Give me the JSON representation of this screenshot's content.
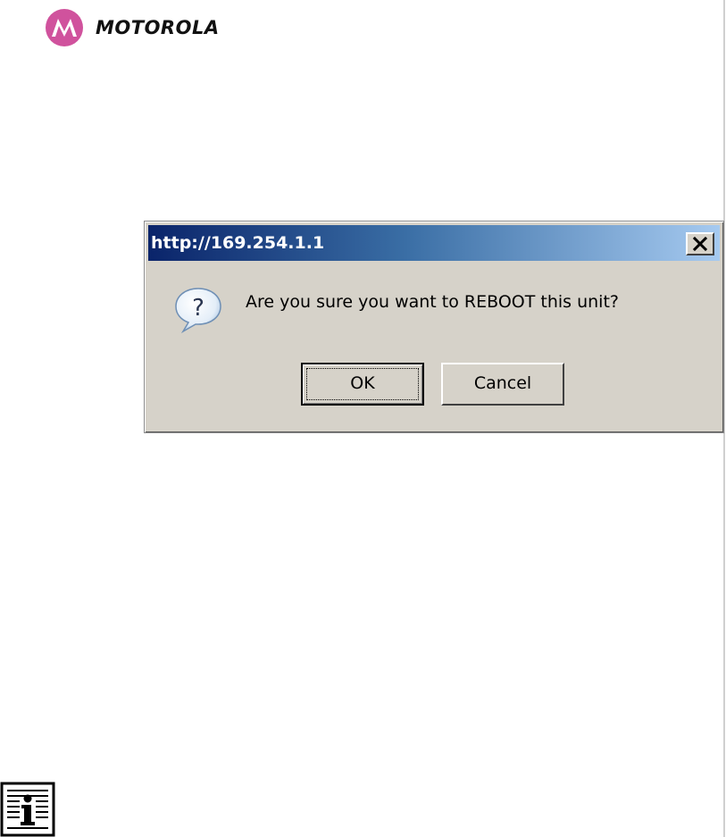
{
  "header": {
    "brand_name": "MOTOROLA",
    "logo_icon": "motorola-batwing-icon",
    "logo_color": "#d0529d"
  },
  "dialog": {
    "title": "http://169.254.1.1",
    "close_icon": "close-icon",
    "message_icon": "question-icon",
    "message": "Are you sure you want to REBOOT this unit?",
    "ok_label": "OK",
    "cancel_label": "Cancel",
    "title_gradient": [
      "#0a246a",
      "#a6caf0"
    ],
    "background": "#d6d2c9"
  },
  "footer": {
    "note_icon": "info-note-icon"
  }
}
